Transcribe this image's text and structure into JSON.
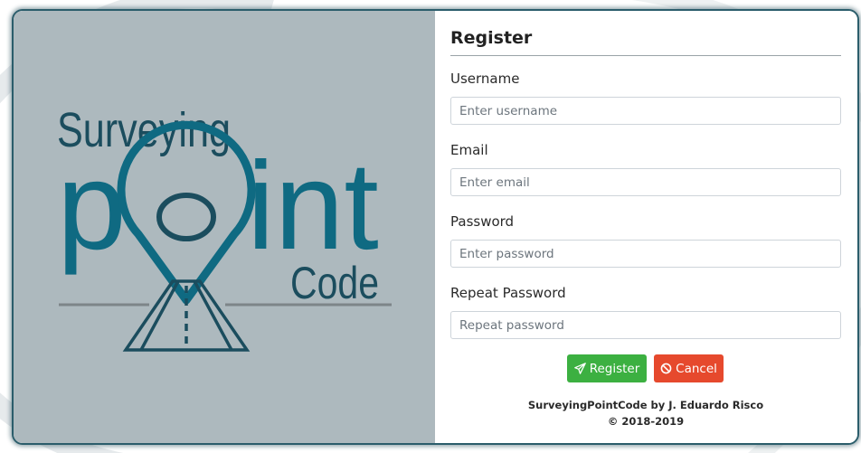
{
  "logo": {
    "line1": "Surveying",
    "line2_start": "p",
    "line2_end": "int",
    "line3": "Code",
    "color_primary": "#0f6a82",
    "color_dark": "#1b4d5e"
  },
  "form": {
    "title": "Register",
    "fields": [
      {
        "label": "Username",
        "placeholder": "Enter username"
      },
      {
        "label": "Email",
        "placeholder": "Enter email"
      },
      {
        "label": "Password",
        "placeholder": "Enter password"
      },
      {
        "label": "Repeat Password",
        "placeholder": "Repeat password"
      }
    ],
    "buttons": {
      "register": {
        "label": "Register",
        "icon": "paper-plane-icon",
        "color": "#3cb041"
      },
      "cancel": {
        "label": "Cancel",
        "icon": "ban-icon",
        "color": "#e6492d"
      }
    }
  },
  "footer": {
    "credit": "SurveyingPointCode by J. Eduardo Risco",
    "copyright": "© 2018-2019"
  }
}
